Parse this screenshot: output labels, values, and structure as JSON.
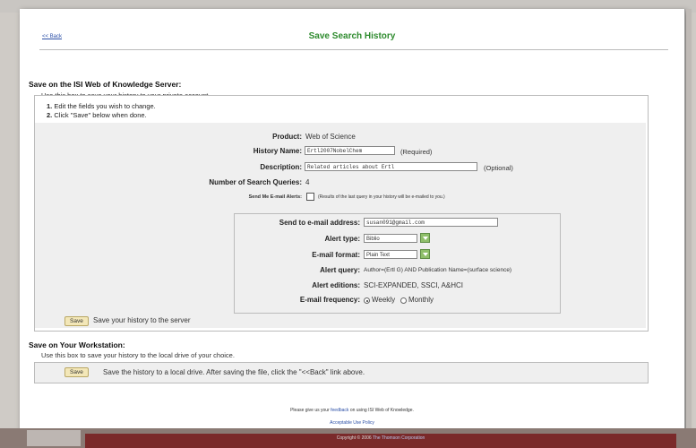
{
  "header": {
    "back_link": "<< Back",
    "title": "Save Search History"
  },
  "server_section": {
    "title": "Save on the ISI Web of Knowledge Server:",
    "description": "Use this box to save your history to your private account.",
    "steps": [
      {
        "num": "1.",
        "text": "Edit the fields you wish to change."
      },
      {
        "num": "2.",
        "text": "Click \"Save\" below when done."
      }
    ],
    "product_label": "Product:",
    "product_value": "Web of Science",
    "history_name_label": "History Name:",
    "history_name_value": "Ertl2007NobelChem",
    "history_name_note": "(Required)",
    "description_label": "Description:",
    "description_value": "Related articles about Ertl",
    "description_note": "(Optional)",
    "queries_label": "Number of Search Queries:",
    "queries_value": "4",
    "alerts_label": "Send Me E-mail Alerts:",
    "alerts_note": "(Results of the last query in your history will be e-mailed to you.)",
    "save_button": "Save",
    "save_text": "Save your history to the server"
  },
  "alert": {
    "email_label": "Send to e-mail address:",
    "email_value": "susan091@gmail.com",
    "type_label": "Alert type:",
    "type_value": "Biblio",
    "format_label": "E-mail format:",
    "format_value": "Plain Text",
    "query_label": "Alert query:",
    "query_value": "Author=(Ertl G) AND Publication Name=(surface science)",
    "editions_label": "Alert editions:",
    "editions_value": "SCI-EXPANDED, SSCI, A&HCI",
    "frequency_label": "E-mail frequency:",
    "weekly": "Weekly",
    "monthly": "Monthly"
  },
  "workstation_section": {
    "title": "Save on Your Workstation:",
    "description": "Use this box to save your history to the local drive of your choice.",
    "save_button": "Save",
    "save_text": "Save the history to a local drive. After saving the file, click the \"<<Back\" link above."
  },
  "footer": {
    "feedback_prefix": "Please give us your",
    "feedback_link": "feedback",
    "feedback_suffix": "on using ISI Web of Knowledge.",
    "policy_link": "Acceptable Use Policy",
    "copyright_prefix": "Copyright © 2006",
    "copyright_link": "The Thomson Corporation"
  },
  "colors": {
    "title_green": "#2e8b2e",
    "link_blue": "#2a4ea6",
    "button_fill": "#f3e7b8",
    "select_button": "#8fbf6a"
  }
}
